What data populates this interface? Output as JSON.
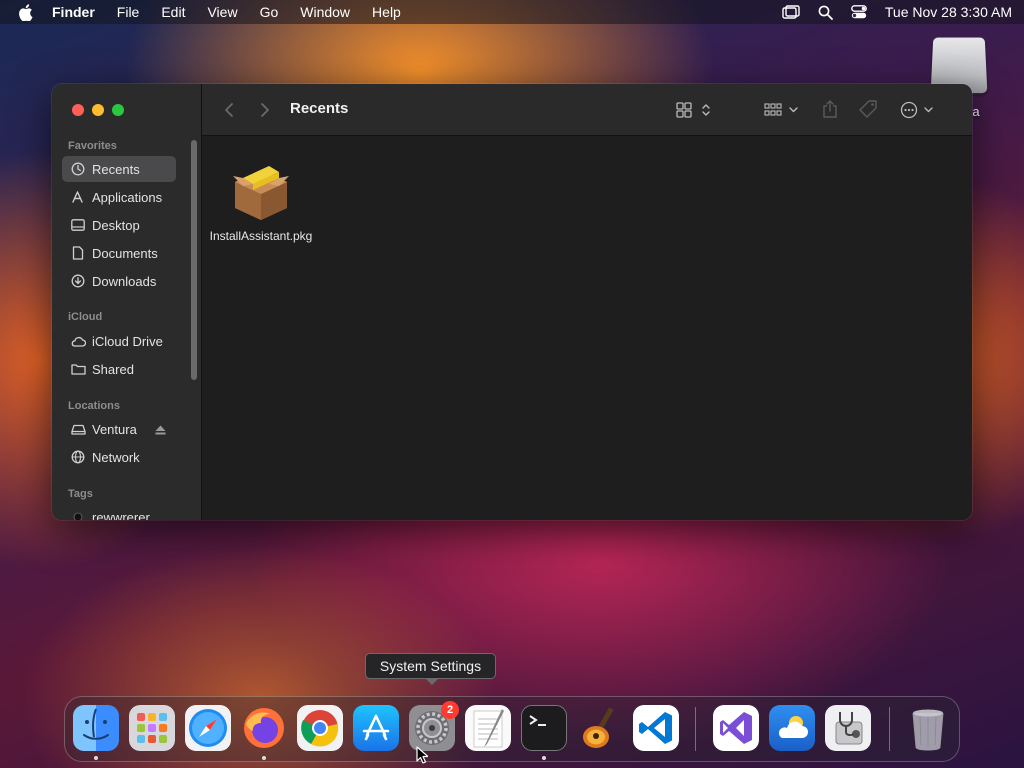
{
  "menubar": {
    "app_name": "Finder",
    "items": [
      "File",
      "Edit",
      "View",
      "Go",
      "Window",
      "Help"
    ],
    "clock": "Tue Nov 28  3:30 AM"
  },
  "desktop": {
    "drive_label": "ra"
  },
  "finder": {
    "title": "Recents",
    "sidebar": {
      "favorites_header": "Favorites",
      "favorites": [
        "Recents",
        "Applications",
        "Desktop",
        "Documents",
        "Downloads"
      ],
      "icloud_header": "iCloud",
      "icloud": [
        "iCloud Drive",
        "Shared"
      ],
      "locations_header": "Locations",
      "locations": [
        "Ventura",
        "Network"
      ],
      "tags_header": "Tags",
      "tags": [
        "rewwrerer"
      ]
    },
    "files": [
      {
        "name": "InstallAssistant.pkg",
        "icon": "package-icon"
      }
    ]
  },
  "tooltip": "System Settings",
  "dock": {
    "apps": [
      "Finder",
      "Launchpad",
      "Safari",
      "Firefox",
      "Chrome",
      "App Store",
      "System Settings",
      "TextEdit",
      "Terminal",
      "GarageBand",
      "Visual Studio Code",
      "Visual Studio",
      "Weather",
      "Disk Utility",
      "Trash"
    ],
    "settings_badge": "2"
  }
}
